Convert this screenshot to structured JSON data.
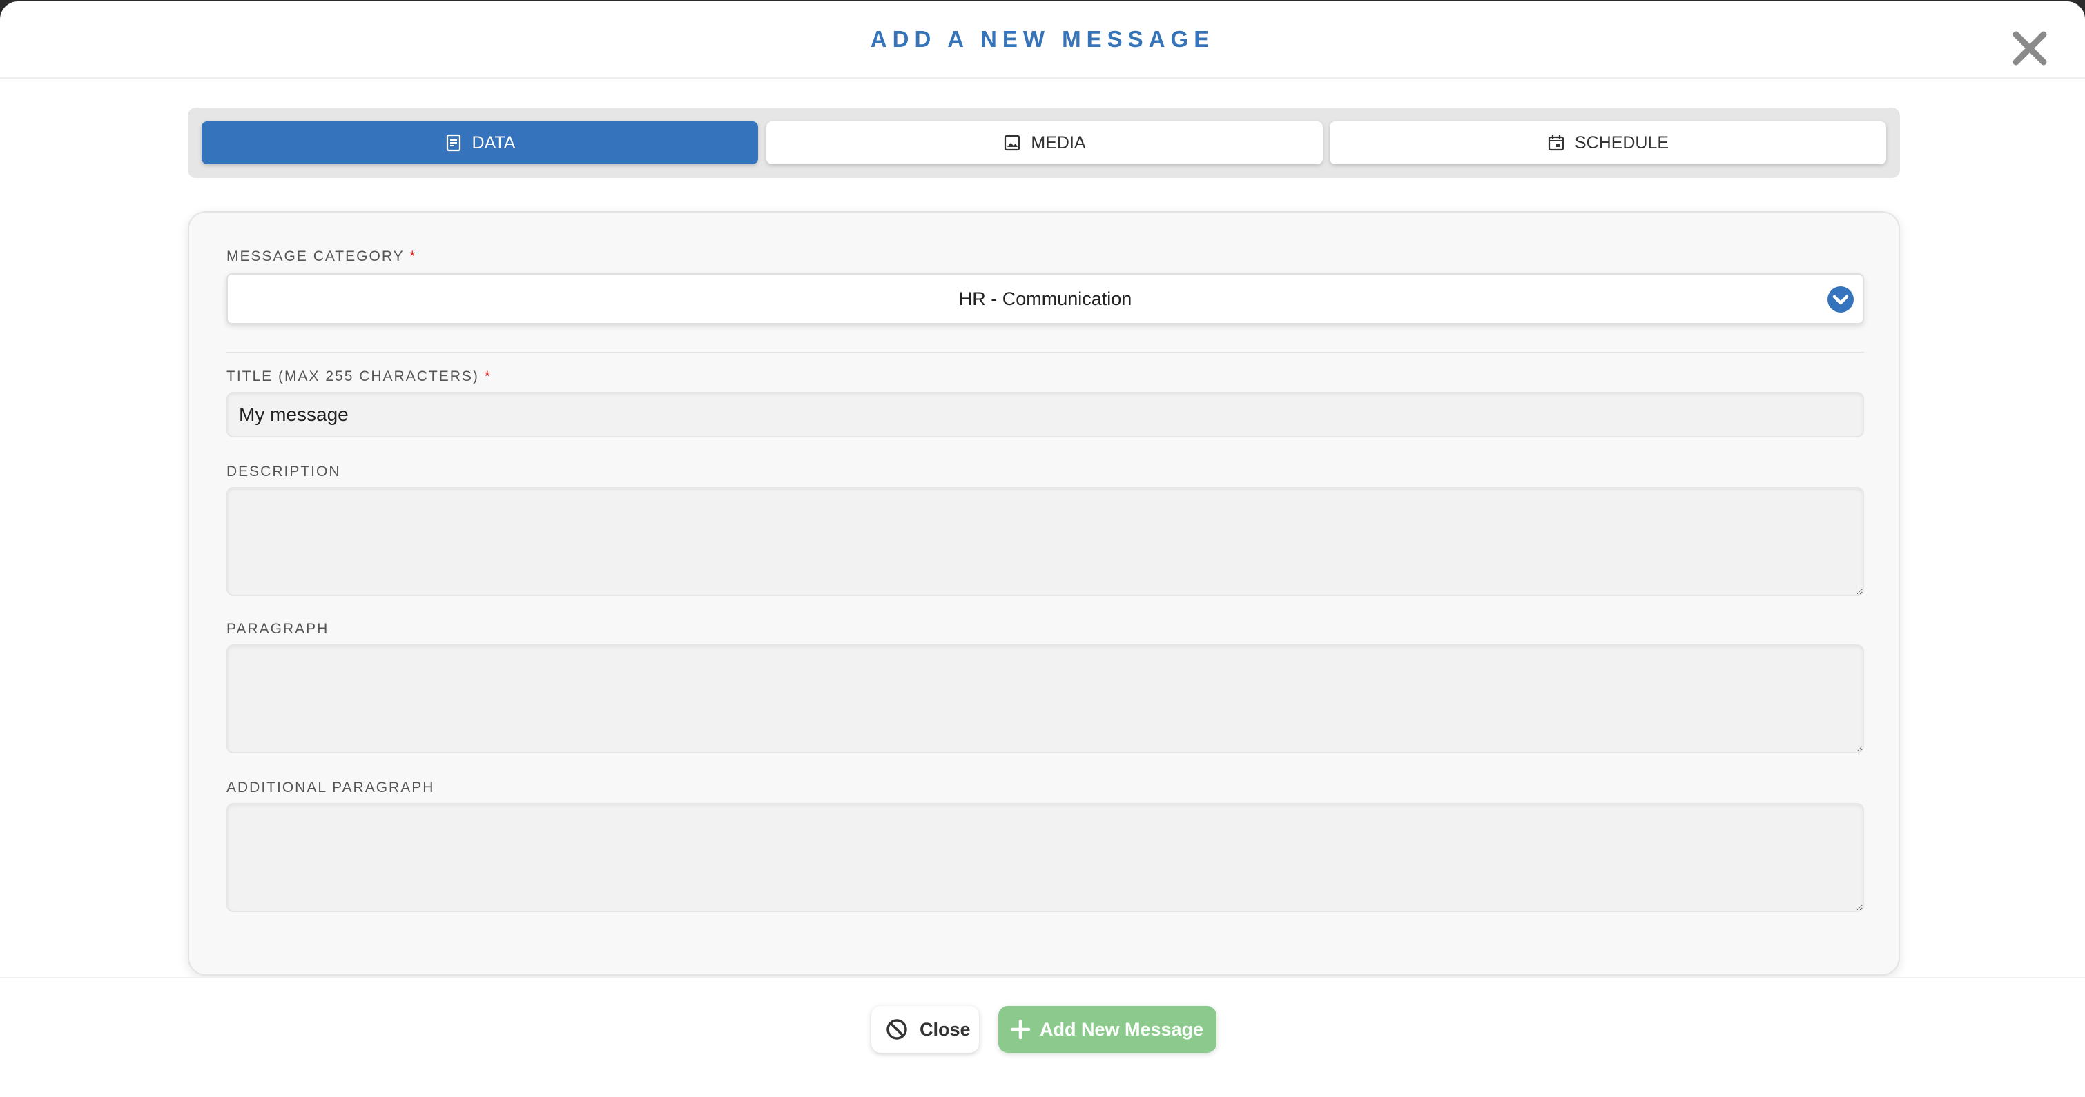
{
  "modal": {
    "title": "ADD A NEW MESSAGE"
  },
  "tabs": [
    {
      "label": "DATA",
      "icon": "document-icon",
      "active": true
    },
    {
      "label": "MEDIA",
      "icon": "image-icon",
      "active": false
    },
    {
      "label": "SCHEDULE",
      "icon": "calendar-icon",
      "active": false
    }
  ],
  "form": {
    "category": {
      "label": "MESSAGE CATEGORY",
      "required_mark": "*",
      "value": "HR - Communication"
    },
    "title": {
      "label": "TITLE (MAX 255 CHARACTERS)",
      "required_mark": "*",
      "value": "My message"
    },
    "description": {
      "label": "DESCRIPTION",
      "value": ""
    },
    "paragraph": {
      "label": "PARAGRAPH",
      "value": ""
    },
    "additional_paragraph": {
      "label": "ADDITIONAL PARAGRAPH",
      "value": ""
    }
  },
  "footer": {
    "close_label": "Close",
    "add_label": "Add New Message"
  },
  "colors": {
    "accent": "#3574b8",
    "active_tab": "#3574bd",
    "add_button": "#8cc98c",
    "required": "#dd2222"
  }
}
